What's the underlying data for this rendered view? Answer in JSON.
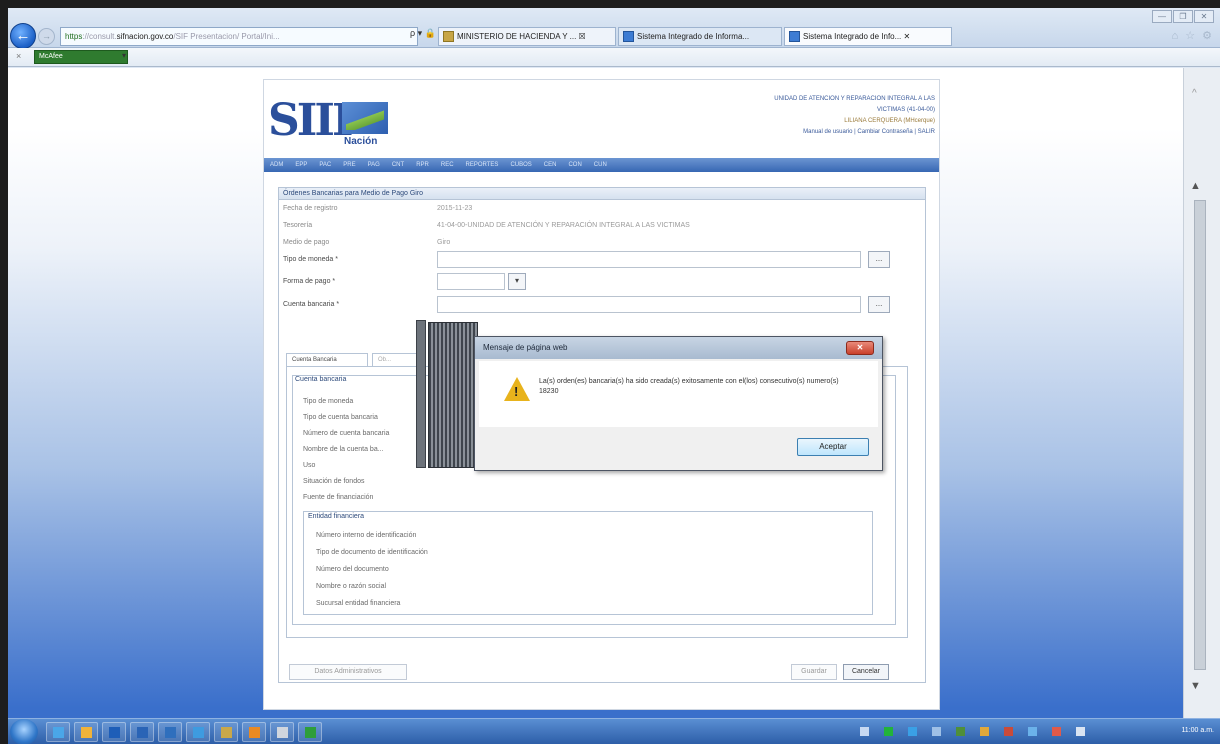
{
  "browser": {
    "address_scheme": "https",
    "address_hidden": "://consult.",
    "address_domain": "sifnacion.gov.co",
    "address_path": "/SIF Presentacion/ Portal/Ini...",
    "address_tools": "ρ ▾ 🔒",
    "tabs": [
      {
        "label": "MINISTERIO DE HACIENDA Y ...  ☒"
      },
      {
        "label": "Sistema Integrado de Informa..."
      },
      {
        "label": "Sistema Integrado de Info... ✕"
      }
    ],
    "window_controls": [
      "—",
      "❐",
      "✕"
    ],
    "nav_icons": "⌂ ☆ ⚙",
    "toolbar_addon": "McAfee",
    "toolbar_close": "×",
    "toolbar_arrow": "▾",
    "back_glyph": "←",
    "forward_glyph": "→"
  },
  "header": {
    "logo_text": "SIIF",
    "logo_subtext": "Nación",
    "entity_line1": "UNIDAD DE ATENCION Y REPARACION INTEGRAL A LAS",
    "entity_line2": "VICTIMAS (41-04-00)",
    "user": "LILIANA CERQUERA (MHcerque)",
    "links": "Manual de usuario | Cambiar Contraseña | SALIR"
  },
  "menu": [
    "ADM",
    "EPP",
    "PAC",
    "PRE",
    "PAG",
    "CNT",
    "RPR",
    "REC",
    "REPORTES",
    "CUBOS",
    "CEN",
    "CON",
    "CUN"
  ],
  "form": {
    "title": "Órdenes Bancarias para Medio de Pago Giro",
    "fecha_label": "Fecha de registro",
    "fecha_value": "2015-11-23",
    "tesoreria_label": "Tesorería",
    "tesoreria_value": "41-04-00-UNIDAD DE ATENCIÓN Y REPARACIÓN INTEGRAL A LAS VICTIMAS",
    "medio_label": "Medio de pago",
    "medio_value": "Giro",
    "tipo_moneda_label": "Tipo de moneda *",
    "forma_pago_label": "Forma de pago *",
    "cuenta_label": "Cuenta bancaria *",
    "ellipsis": "...",
    "dropdown_glyph": "▾",
    "tabs": [
      "Cuenta Bancaria",
      "Ob..."
    ],
    "cuenta_group_title": "Cuenta bancaria",
    "cuenta_items": [
      "Tipo de moneda",
      "Tipo de cuenta bancaria",
      "Número de cuenta bancaria",
      "Nombre de la cuenta ba...",
      "Uso",
      "Situación de fondos",
      "Fuente de financiación"
    ],
    "entidad_group_title": "Entidad financiera",
    "entidad_items": [
      "Número interno de identificación",
      "Tipo de documento de identificación",
      "Número del documento",
      "Nombre o razón social",
      "Sucursal entidad financiera"
    ],
    "btn_datos": "Datos Administrativos",
    "btn_guardar": "Guardar",
    "btn_cancelar": "Cancelar"
  },
  "dialog": {
    "title": "Mensaje de página web",
    "close": "✕",
    "message": "La(s) orden(es) bancaria(s) ha sido creada(s) exitosamente con el(los) consecutivo(s) numero(s) 18230",
    "ok": "Aceptar"
  },
  "taskbar": {
    "clock": "11:00 a.m."
  },
  "scrollbar": {
    "up": "▲",
    "down": "▼",
    "page_up": "^"
  }
}
